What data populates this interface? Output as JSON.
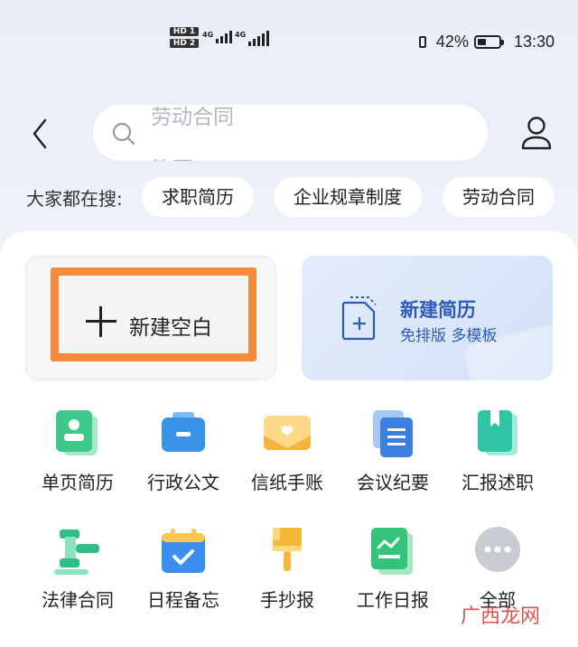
{
  "status_bar": {
    "sim1": "HD 1",
    "sim2": "HD 2",
    "net1": "4G",
    "net2": "4G",
    "battery": "42%",
    "battery_level": 0.42,
    "time": "13:30"
  },
  "header": {
    "search_rolling_1": "劳动合同",
    "search_rolling_2": "简历"
  },
  "hot_search": {
    "label": "大家都在搜:",
    "chips": [
      "求职简历",
      "企业规章制度",
      "劳动合同"
    ]
  },
  "create": {
    "blank_label": "新建空白",
    "resume_title": "新建简历",
    "resume_subtitle": "免排版 多模板"
  },
  "tools_row1": [
    {
      "label": "单页简历",
      "icon": "profile-card-icon",
      "color": "#3dc98a"
    },
    {
      "label": "行政公文",
      "icon": "briefcase-icon",
      "color": "#3b93e8"
    },
    {
      "label": "信纸手账",
      "icon": "envelope-heart-icon",
      "color": "#f6b33d"
    },
    {
      "label": "会议纪要",
      "icon": "notes-stack-icon",
      "color": "#3b7fe0"
    },
    {
      "label": "汇报述职",
      "icon": "bookmark-book-icon",
      "color": "#2fc6a8"
    }
  ],
  "tools_row2": [
    {
      "label": "法律合同",
      "icon": "gavel-icon",
      "color": "#2fbf86"
    },
    {
      "label": "日程备忘",
      "icon": "calendar-check-icon",
      "color": "#3b8ef0"
    },
    {
      "label": "手抄报",
      "icon": "paint-brush-icon",
      "color": "#f5b83a"
    },
    {
      "label": "工作日报",
      "icon": "chart-report-icon",
      "color": "#33c47a"
    },
    {
      "label": "全部",
      "icon": "more-dots-icon",
      "color": "#c9ccd3"
    }
  ],
  "watermark": "广西龙网"
}
